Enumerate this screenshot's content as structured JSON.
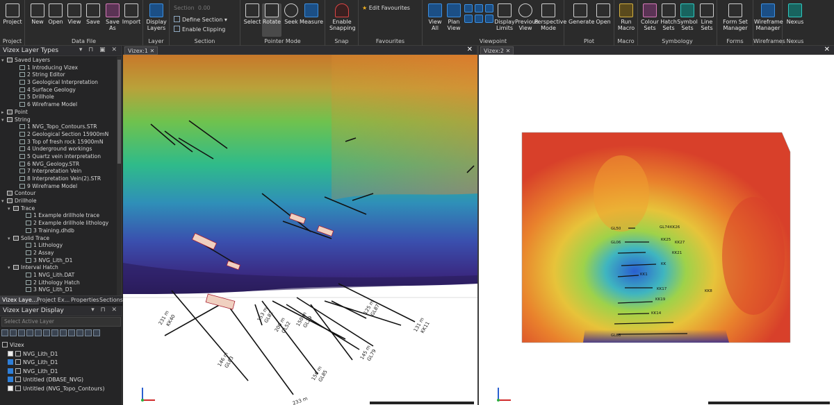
{
  "ribbon": {
    "groups": {
      "project": "Project",
      "datafile": "Data File",
      "layer": "Layer",
      "section": "Section",
      "pointermode": "Pointer Mode",
      "snap": "Snap",
      "favourites": "Favourites",
      "viewpoint": "Viewpoint",
      "plot": "Plot",
      "macro": "Macro",
      "symbology": "Symbology",
      "forms": "Forms",
      "wireframes": "Wireframes",
      "nexus": "Nexus"
    },
    "buttons": {
      "project": "Project",
      "new": "New",
      "open": "Open",
      "view": "View",
      "save": "Save",
      "save_as": "Save As",
      "import": "Import",
      "display_layers": "Display Layers",
      "section_label": "Section",
      "section_value": "0.00",
      "define_section": "Define Section",
      "enable_clipping": "Enable Clipping",
      "select": "Select",
      "rotate": "Rotate",
      "seek": "Seek",
      "measure": "Measure",
      "enable_snapping": "Enable Snapping",
      "edit_favourites": "Edit Favourites",
      "view_all": "View All",
      "plan_view": "Plan View",
      "display_limits": "Display Limits",
      "previous_view": "Previous View",
      "perspective_mode": "Perspective Mode",
      "generate": "Generate",
      "plot_open": "Open",
      "run_macro": "Run Macro",
      "colour_sets": "Colour Sets",
      "hatch_sets": "Hatch Sets",
      "symbol_sets": "Symbol Sets",
      "line_sets": "Line Sets",
      "form_set_manager": "Form Set Manager",
      "wireframe_manager": "Wireframe Manager",
      "nexus": "Nexus"
    }
  },
  "layer_types": {
    "title": "Vizex Layer Types",
    "items": [
      {
        "label": "Saved Layers",
        "level": 0,
        "exp": "▾",
        "type": "folder"
      },
      {
        "label": "1 Introducing Vizex",
        "level": 2,
        "exp": "",
        "type": "item"
      },
      {
        "label": "2 String Editor",
        "level": 2,
        "exp": "",
        "type": "item"
      },
      {
        "label": "3 Geological Interpretation",
        "level": 2,
        "exp": "",
        "type": "item"
      },
      {
        "label": "4 Surface Geology",
        "level": 2,
        "exp": "",
        "type": "item"
      },
      {
        "label": "5 Drillhole",
        "level": 2,
        "exp": "",
        "type": "item"
      },
      {
        "label": "6 Wireframe Model",
        "level": 2,
        "exp": "",
        "type": "item"
      },
      {
        "label": "Point",
        "level": 0,
        "exp": "▸",
        "type": "folder"
      },
      {
        "label": "String",
        "level": 0,
        "exp": "▾",
        "type": "folder"
      },
      {
        "label": "1 NVG_Topo_Contours.STR",
        "level": 2,
        "exp": "",
        "type": "item"
      },
      {
        "label": "2 Geological Section 15900mN",
        "level": 2,
        "exp": "",
        "type": "item"
      },
      {
        "label": "3 Top of fresh rock 15900mN",
        "level": 2,
        "exp": "",
        "type": "item"
      },
      {
        "label": "4 Underground workings",
        "level": 2,
        "exp": "",
        "type": "item"
      },
      {
        "label": "5 Quartz vein interpretation",
        "level": 2,
        "exp": "",
        "type": "item"
      },
      {
        "label": "6 NVG_Geology.STR",
        "level": 2,
        "exp": "",
        "type": "item"
      },
      {
        "label": "7 Interpretation Vein",
        "level": 2,
        "exp": "",
        "type": "item"
      },
      {
        "label": "8 Interpretation Vein(2).STR",
        "level": 2,
        "exp": "",
        "type": "item"
      },
      {
        "label": "9 Wireframe Model",
        "level": 2,
        "exp": "",
        "type": "item"
      },
      {
        "label": "Contour",
        "level": 0,
        "exp": "",
        "type": "folder"
      },
      {
        "label": "Drillhole",
        "level": 0,
        "exp": "▾",
        "type": "folder"
      },
      {
        "label": "Trace",
        "level": 1,
        "exp": "▾",
        "type": "folder"
      },
      {
        "label": "1 Example drillhole trace",
        "level": 3,
        "exp": "",
        "type": "item"
      },
      {
        "label": "2 Example drillhole lithology",
        "level": 3,
        "exp": "",
        "type": "item"
      },
      {
        "label": "3 Training.dhdb",
        "level": 3,
        "exp": "",
        "type": "item"
      },
      {
        "label": "Solid Trace",
        "level": 1,
        "exp": "▾",
        "type": "folder"
      },
      {
        "label": "1 Lithology",
        "level": 3,
        "exp": "",
        "type": "item"
      },
      {
        "label": "2 Assay",
        "level": 3,
        "exp": "",
        "type": "item"
      },
      {
        "label": "3 NVG_Lith_D1",
        "level": 3,
        "exp": "",
        "type": "item"
      },
      {
        "label": "Interval Hatch",
        "level": 1,
        "exp": "▾",
        "type": "folder"
      },
      {
        "label": "1 NVG_Lith.DAT",
        "level": 3,
        "exp": "",
        "type": "item"
      },
      {
        "label": "2 Lithology Hatch",
        "level": 3,
        "exp": "",
        "type": "item"
      },
      {
        "label": "3 NVG_Lith_D1",
        "level": 3,
        "exp": "",
        "type": "item"
      }
    ]
  },
  "left_tabs": [
    "Vizex Laye...",
    "Project Ex...",
    "Properties",
    "Sections"
  ],
  "layer_display": {
    "title": "Vizex Layer Display",
    "select_placeholder": "Select Active Layer",
    "items": [
      {
        "label": "Vizex",
        "checked": null
      },
      {
        "label": "NVG_Lith_D1",
        "checked": false
      },
      {
        "label": "NVG_Lith_D1",
        "checked": true
      },
      {
        "label": "NVG_Lith_D1",
        "checked": true
      },
      {
        "label": "Untitled (DBASE_NVG)",
        "checked": true
      },
      {
        "label": "Untitled (NVG_Topo_Contours)",
        "checked": false
      }
    ]
  },
  "viewers": {
    "v1_tab": "Vizex:1",
    "v2_tab": "Vizex:2"
  },
  "v1_labels": [
    "231 m",
    "KK40",
    "146 m",
    "GL83",
    "156 m",
    "GL85",
    "200 m",
    "GL52",
    "150 m",
    "GL29",
    "125 m",
    "GL87",
    "153 m",
    "GL82",
    "131 m",
    "KK11",
    "145 m",
    "GL79",
    "GL87",
    "233 m",
    "GL03"
  ],
  "v2_labels": [
    "GL50",
    "GL74",
    "KK26",
    "GL06",
    "KK25",
    "KK27",
    "KK21",
    "KK",
    "KK1",
    "KK17",
    "KK19",
    "KK14",
    "GL88",
    "KK8"
  ]
}
